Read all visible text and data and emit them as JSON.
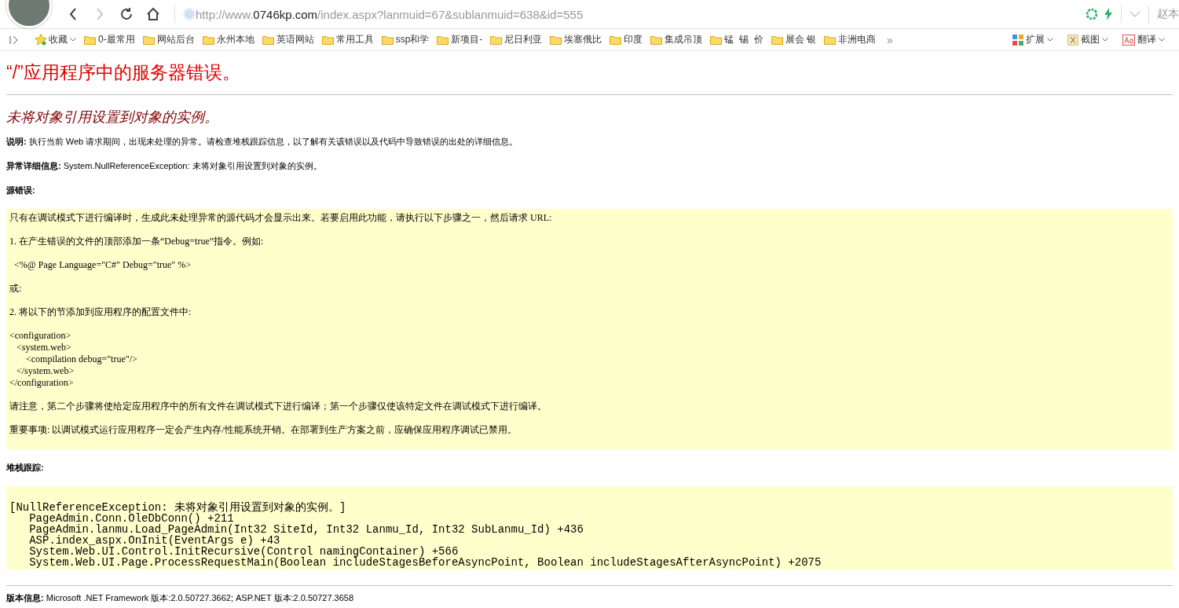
{
  "browser": {
    "nav": [
      {
        "kind": "back",
        "disabled": false
      },
      {
        "kind": "forward",
        "disabled": true
      },
      {
        "kind": "reload",
        "disabled": false
      },
      {
        "kind": "home",
        "disabled": false
      }
    ],
    "url": {
      "prefix": "http://www.",
      "host": "0746kp.com",
      "path": "/index.aspx?lanmuid=67&sublanmuid=638&id=555"
    },
    "user": "赵本"
  },
  "bookmarks": {
    "favorites": "收藏",
    "folders": [
      "0-最常用",
      "网站后台",
      "永州本地",
      "英语网站",
      "常用工具",
      "ssp和学",
      "新项目-",
      "尼日利亚",
      "埃塞俄比",
      "印度",
      "集成吊顶",
      "锰  锡  价",
      "展会 银",
      "非洲电商"
    ],
    "more": "»",
    "tools": [
      {
        "kind": "extensions",
        "label": "扩展"
      },
      {
        "kind": "screenshot",
        "label": "截图"
      },
      {
        "kind": "translate",
        "label": "翻译"
      }
    ]
  },
  "page": {
    "title": "“/”应用程序中的服务器错误。",
    "subtitle": "未将对象引用设置到对象的实例。",
    "info": [
      "**说明:** 执行当前 Web 请求期间，出现未处理的异常。请检查堆栈跟踪信息，以了解有关该错误以及代码中导致错误的出处的详细信息。",
      "**异常详细信息:** System.NullReferenceException: 未将对象引用设置到对象的实例。"
    ],
    "source_heading": "源错误:",
    "source_block": [
      {
        "kind": "para",
        "text": "只有在调试模式下进行编译时，生成此未处理异常的源代码才会显示出来。若要启用此功能，请执行以下步骤之一，然后请求 URL:"
      },
      {
        "kind": "para",
        "text": "1. 在产生错误的文件的顶部添加一条“Debug=true”指令。例如:"
      },
      {
        "kind": "para",
        "text": "  <%@ Page Language=\"C#\" Debug=\"true\" %>"
      },
      {
        "kind": "para",
        "text": "或:"
      },
      {
        "kind": "para",
        "text": "2. 将以下的节添加到应用程序的配置文件中:"
      },
      {
        "kind": "code",
        "lines": [
          "<configuration>",
          "   <system.web>",
          "       <compilation debug=\"true\"/>",
          "   </system.web>",
          "</configuration>"
        ]
      },
      {
        "kind": "para",
        "text": "请注意，第二个步骤将使给定应用程序中的所有文件在调试模式下进行编译；第一个步骤仅使该特定文件在调试模式下进行编译。"
      },
      {
        "kind": "para",
        "text": "重要事项: 以调试模式运行应用程序一定会产生内存/性能系统开销。在部署到生产方案之前，应确保应用程序调试已禁用。"
      }
    ],
    "stack_heading": "堆栈跟踪:",
    "stack_trace": [
      "[NullReferenceException: 未将对象引用设置到对象的实例。]",
      "   PageAdmin.Conn.OleDbConn() +211",
      "   PageAdmin.lanmu.Load_PageAdmin(Int32 SiteId, Int32 Lanmu_Id, Int32 SubLanmu_Id) +436",
      "   ASP.index_aspx.OnInit(EventArgs e) +43",
      "   System.Web.UI.Control.InitRecursive(Control namingContainer) +566",
      "   System.Web.UI.Page.ProcessRequestMain(Boolean includeStagesBeforeAsyncPoint, Boolean includeStagesAfterAsyncPoint) +2075"
    ],
    "version": "**版本信息:** Microsoft .NET Framework 版本:2.0.50727.3662; ASP.NET 版本:2.0.50727.3658"
  }
}
